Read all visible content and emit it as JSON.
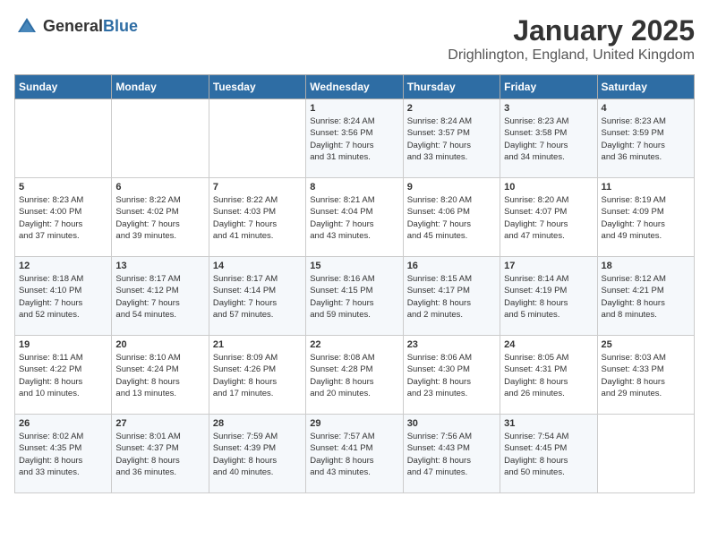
{
  "logo": {
    "general": "General",
    "blue": "Blue"
  },
  "title": "January 2025",
  "location": "Drighlington, England, United Kingdom",
  "days_of_week": [
    "Sunday",
    "Monday",
    "Tuesday",
    "Wednesday",
    "Thursday",
    "Friday",
    "Saturday"
  ],
  "weeks": [
    [
      {
        "day": "",
        "info": ""
      },
      {
        "day": "",
        "info": ""
      },
      {
        "day": "",
        "info": ""
      },
      {
        "day": "1",
        "info": "Sunrise: 8:24 AM\nSunset: 3:56 PM\nDaylight: 7 hours\nand 31 minutes."
      },
      {
        "day": "2",
        "info": "Sunrise: 8:24 AM\nSunset: 3:57 PM\nDaylight: 7 hours\nand 33 minutes."
      },
      {
        "day": "3",
        "info": "Sunrise: 8:23 AM\nSunset: 3:58 PM\nDaylight: 7 hours\nand 34 minutes."
      },
      {
        "day": "4",
        "info": "Sunrise: 8:23 AM\nSunset: 3:59 PM\nDaylight: 7 hours\nand 36 minutes."
      }
    ],
    [
      {
        "day": "5",
        "info": "Sunrise: 8:23 AM\nSunset: 4:00 PM\nDaylight: 7 hours\nand 37 minutes."
      },
      {
        "day": "6",
        "info": "Sunrise: 8:22 AM\nSunset: 4:02 PM\nDaylight: 7 hours\nand 39 minutes."
      },
      {
        "day": "7",
        "info": "Sunrise: 8:22 AM\nSunset: 4:03 PM\nDaylight: 7 hours\nand 41 minutes."
      },
      {
        "day": "8",
        "info": "Sunrise: 8:21 AM\nSunset: 4:04 PM\nDaylight: 7 hours\nand 43 minutes."
      },
      {
        "day": "9",
        "info": "Sunrise: 8:20 AM\nSunset: 4:06 PM\nDaylight: 7 hours\nand 45 minutes."
      },
      {
        "day": "10",
        "info": "Sunrise: 8:20 AM\nSunset: 4:07 PM\nDaylight: 7 hours\nand 47 minutes."
      },
      {
        "day": "11",
        "info": "Sunrise: 8:19 AM\nSunset: 4:09 PM\nDaylight: 7 hours\nand 49 minutes."
      }
    ],
    [
      {
        "day": "12",
        "info": "Sunrise: 8:18 AM\nSunset: 4:10 PM\nDaylight: 7 hours\nand 52 minutes."
      },
      {
        "day": "13",
        "info": "Sunrise: 8:17 AM\nSunset: 4:12 PM\nDaylight: 7 hours\nand 54 minutes."
      },
      {
        "day": "14",
        "info": "Sunrise: 8:17 AM\nSunset: 4:14 PM\nDaylight: 7 hours\nand 57 minutes."
      },
      {
        "day": "15",
        "info": "Sunrise: 8:16 AM\nSunset: 4:15 PM\nDaylight: 7 hours\nand 59 minutes."
      },
      {
        "day": "16",
        "info": "Sunrise: 8:15 AM\nSunset: 4:17 PM\nDaylight: 8 hours\nand 2 minutes."
      },
      {
        "day": "17",
        "info": "Sunrise: 8:14 AM\nSunset: 4:19 PM\nDaylight: 8 hours\nand 5 minutes."
      },
      {
        "day": "18",
        "info": "Sunrise: 8:12 AM\nSunset: 4:21 PM\nDaylight: 8 hours\nand 8 minutes."
      }
    ],
    [
      {
        "day": "19",
        "info": "Sunrise: 8:11 AM\nSunset: 4:22 PM\nDaylight: 8 hours\nand 10 minutes."
      },
      {
        "day": "20",
        "info": "Sunrise: 8:10 AM\nSunset: 4:24 PM\nDaylight: 8 hours\nand 13 minutes."
      },
      {
        "day": "21",
        "info": "Sunrise: 8:09 AM\nSunset: 4:26 PM\nDaylight: 8 hours\nand 17 minutes."
      },
      {
        "day": "22",
        "info": "Sunrise: 8:08 AM\nSunset: 4:28 PM\nDaylight: 8 hours\nand 20 minutes."
      },
      {
        "day": "23",
        "info": "Sunrise: 8:06 AM\nSunset: 4:30 PM\nDaylight: 8 hours\nand 23 minutes."
      },
      {
        "day": "24",
        "info": "Sunrise: 8:05 AM\nSunset: 4:31 PM\nDaylight: 8 hours\nand 26 minutes."
      },
      {
        "day": "25",
        "info": "Sunrise: 8:03 AM\nSunset: 4:33 PM\nDaylight: 8 hours\nand 29 minutes."
      }
    ],
    [
      {
        "day": "26",
        "info": "Sunrise: 8:02 AM\nSunset: 4:35 PM\nDaylight: 8 hours\nand 33 minutes."
      },
      {
        "day": "27",
        "info": "Sunrise: 8:01 AM\nSunset: 4:37 PM\nDaylight: 8 hours\nand 36 minutes."
      },
      {
        "day": "28",
        "info": "Sunrise: 7:59 AM\nSunset: 4:39 PM\nDaylight: 8 hours\nand 40 minutes."
      },
      {
        "day": "29",
        "info": "Sunrise: 7:57 AM\nSunset: 4:41 PM\nDaylight: 8 hours\nand 43 minutes."
      },
      {
        "day": "30",
        "info": "Sunrise: 7:56 AM\nSunset: 4:43 PM\nDaylight: 8 hours\nand 47 minutes."
      },
      {
        "day": "31",
        "info": "Sunrise: 7:54 AM\nSunset: 4:45 PM\nDaylight: 8 hours\nand 50 minutes."
      },
      {
        "day": "",
        "info": ""
      }
    ]
  ]
}
